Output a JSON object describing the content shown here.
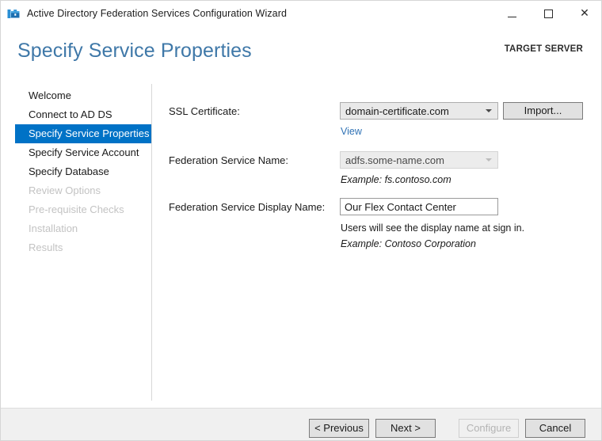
{
  "window": {
    "title": "Active Directory Federation Services Configuration Wizard",
    "icon": "adfs-wizard-icon",
    "controls": {
      "minimize": "minimize-icon",
      "maximize": "maximize-icon",
      "close": "close-icon"
    }
  },
  "header": {
    "page_title": "Specify Service Properties",
    "target_server_label": "TARGET SERVER",
    "accent_color": "#3f78a8"
  },
  "sidebar": {
    "selected_index": 2,
    "selection_color": "#0072c6",
    "items": [
      {
        "label": "Welcome",
        "state": "enabled"
      },
      {
        "label": "Connect to AD DS",
        "state": "enabled"
      },
      {
        "label": "Specify Service Properties",
        "state": "selected"
      },
      {
        "label": "Specify Service Account",
        "state": "enabled"
      },
      {
        "label": "Specify Database",
        "state": "enabled"
      },
      {
        "label": "Review Options",
        "state": "disabled"
      },
      {
        "label": "Pre-requisite Checks",
        "state": "disabled"
      },
      {
        "label": "Installation",
        "state": "disabled"
      },
      {
        "label": "Results",
        "state": "disabled"
      }
    ]
  },
  "form": {
    "ssl_certificate": {
      "label": "SSL Certificate:",
      "value": "domain-certificate.com",
      "caret_icon": "chevron-down-icon",
      "import_button": "Import...",
      "view_link": "View",
      "link_color": "#2f72b5"
    },
    "federation_service_name": {
      "label": "Federation Service Name:",
      "value": "adfs.some-name.com",
      "caret_icon": "chevron-down-icon",
      "example": "Example: fs.contoso.com",
      "enabled": false
    },
    "federation_service_display_name": {
      "label": "Federation Service Display Name:",
      "value": "Our Flex Contact Center",
      "placeholder": "",
      "hint": "Users will see the display name at sign in.",
      "example": "Example: Contoso Corporation"
    }
  },
  "footer": {
    "previous": "< Previous",
    "next": "Next >",
    "configure": "Configure",
    "cancel": "Cancel",
    "configure_enabled": false
  }
}
